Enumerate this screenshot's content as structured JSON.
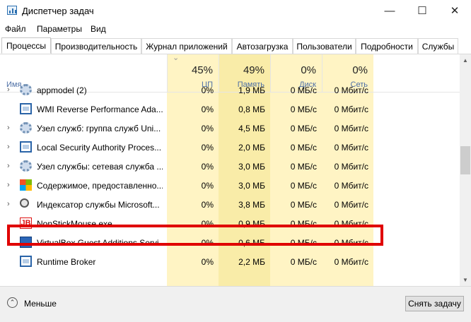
{
  "window": {
    "title": "Диспетчер задач",
    "minimize_glyph": "—",
    "maximize_glyph": "☐",
    "close_glyph": "✕"
  },
  "menu": [
    "Файл",
    "Параметры",
    "Вид"
  ],
  "tabs": [
    "Процессы",
    "Производительность",
    "Журнал приложений",
    "Автозагрузка",
    "Пользователи",
    "Подробности",
    "Службы"
  ],
  "header": {
    "name_label": "Имя",
    "columns": [
      {
        "percent": "45%",
        "label": "ЦП"
      },
      {
        "percent": "49%",
        "label": "Память"
      },
      {
        "percent": "0%",
        "label": "Диск"
      },
      {
        "percent": "0%",
        "label": "Сеть"
      }
    ]
  },
  "rows": [
    {
      "name": "appmodel (2)",
      "icon": "gear-icon",
      "expand": true,
      "cpu": "0%",
      "mem": "1,9 МБ",
      "disk": "0 МБ/с",
      "net": "0 Мбит/с"
    },
    {
      "name": "WMI Reverse Performance Ada...",
      "icon": "window-icon",
      "expand": false,
      "cpu": "0%",
      "mem": "0,8 МБ",
      "disk": "0 МБ/с",
      "net": "0 Мбит/с"
    },
    {
      "name": "Узел служб: группа служб Uni...",
      "icon": "gear-icon",
      "expand": true,
      "cpu": "0%",
      "mem": "4,5 МБ",
      "disk": "0 МБ/с",
      "net": "0 Мбит/с"
    },
    {
      "name": "Local Security Authority Proces...",
      "icon": "window-icon",
      "expand": true,
      "cpu": "0%",
      "mem": "2,0 МБ",
      "disk": "0 МБ/с",
      "net": "0 Мбит/с"
    },
    {
      "name": "Узел службы: сетевая служба ...",
      "icon": "gear-icon",
      "expand": true,
      "cpu": "0%",
      "mem": "3,0 МБ",
      "disk": "0 МБ/с",
      "net": "0 Мбит/с"
    },
    {
      "name": "Содержимое, предоставленно...",
      "icon": "tiles-icon",
      "expand": true,
      "cpu": "0%",
      "mem": "3,0 МБ",
      "disk": "0 МБ/с",
      "net": "0 Мбит/с"
    },
    {
      "name": "Индексатор службы Microsoft...",
      "icon": "search-icon",
      "expand": true,
      "cpu": "0%",
      "mem": "3,8 МБ",
      "disk": "0 МБ/с",
      "net": "0 Мбит/с"
    },
    {
      "name": "NonStickMouse.exe",
      "icon": "jb-icon",
      "icon_text": "JB",
      "expand": false,
      "cpu": "0%",
      "mem": "0,9 МБ",
      "disk": "0 МБ/с",
      "net": "0 Мбит/с"
    },
    {
      "name": "VirtualBox Guest Additions Servi...",
      "icon": "virtualbox-icon",
      "expand": true,
      "cpu": "0%",
      "mem": "0,6 МБ",
      "disk": "0 МБ/с",
      "net": "0 Мбит/с"
    },
    {
      "name": "Runtime Broker",
      "icon": "window-icon",
      "expand": false,
      "cpu": "0%",
      "mem": "2,2 МБ",
      "disk": "0 МБ/с",
      "net": "0 Мбит/с"
    }
  ],
  "footer": {
    "less_label": "Меньше",
    "end_task_label": "Снять задачу"
  },
  "colors": {
    "cpu_column_bg": "#fff4c4",
    "memory_column_bg": "#f9eca8",
    "disk_column_bg": "#fff4c4",
    "network_column_bg": "#fff4c4",
    "highlight": "#e00000"
  }
}
